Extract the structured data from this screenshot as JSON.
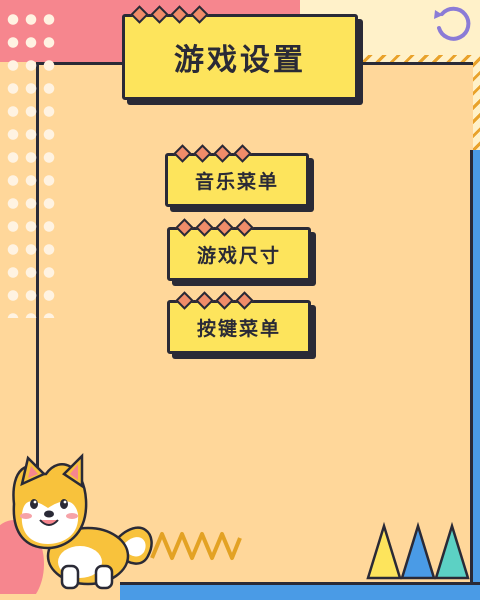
{
  "title": "游戏设置",
  "menu": [
    {
      "id": "music",
      "label": "音乐菜单"
    },
    {
      "id": "size",
      "label": "游戏尺寸"
    },
    {
      "id": "keys",
      "label": "按键菜单"
    }
  ],
  "icons": {
    "back": "undo-arrow-icon",
    "mascot": "shiba-dog-mascot"
  },
  "colors": {
    "background": "#ffd79a",
    "card": "#fde45c",
    "accent_pink": "#f6868e",
    "accent_blue": "#4a9be6",
    "outline": "#2a2a36"
  }
}
